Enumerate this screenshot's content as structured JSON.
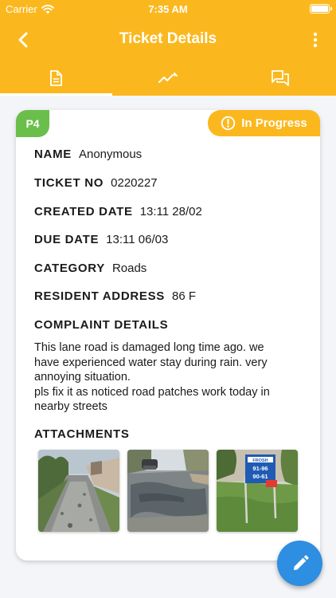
{
  "status_bar": {
    "carrier": "Carrier",
    "time": "7:35 AM"
  },
  "header": {
    "title": "Ticket Details"
  },
  "tabs": [
    {
      "name": "details",
      "icon": "document-icon",
      "active": true
    },
    {
      "name": "activity",
      "icon": "trend-line-icon",
      "active": false
    },
    {
      "name": "comments",
      "icon": "chat-icon",
      "active": false
    }
  ],
  "ticket": {
    "priority": "P4",
    "status": "In Progress",
    "fields": {
      "name": {
        "label": "NAME",
        "value": "Anonymous"
      },
      "ticket_no": {
        "label": "TICKET NO",
        "value": "0220227"
      },
      "created_date": {
        "label": "CREATED DATE",
        "value": "13:11 28/02"
      },
      "due_date": {
        "label": "DUE DATE",
        "value": "13:11 06/03"
      },
      "category": {
        "label": "CATEGORY",
        "value": "Roads"
      },
      "resident_address": {
        "label": "RESIDENT ADDRESS",
        "value": "86 F"
      }
    },
    "complaint_title": "COMPLAINT DETAILS",
    "complaint_lines": [
      "This lane road is damaged long time ago. we",
      "have experienced water stay during rain. very",
      "annoying situation.",
      "pls fix it as noticed road patches work today in",
      "nearby streets"
    ],
    "attachments_title": "ATTACHMENTS",
    "attachments": [
      {
        "name": "attachment-photo-1"
      },
      {
        "name": "attachment-photo-2"
      },
      {
        "name": "attachment-photo-3",
        "sign_lines": [
          "FROSH",
          "91-96",
          "90-61"
        ]
      }
    ]
  },
  "colors": {
    "brand": "#fbb81e",
    "priority": "#6abf4b",
    "fab": "#2d8ee2"
  }
}
